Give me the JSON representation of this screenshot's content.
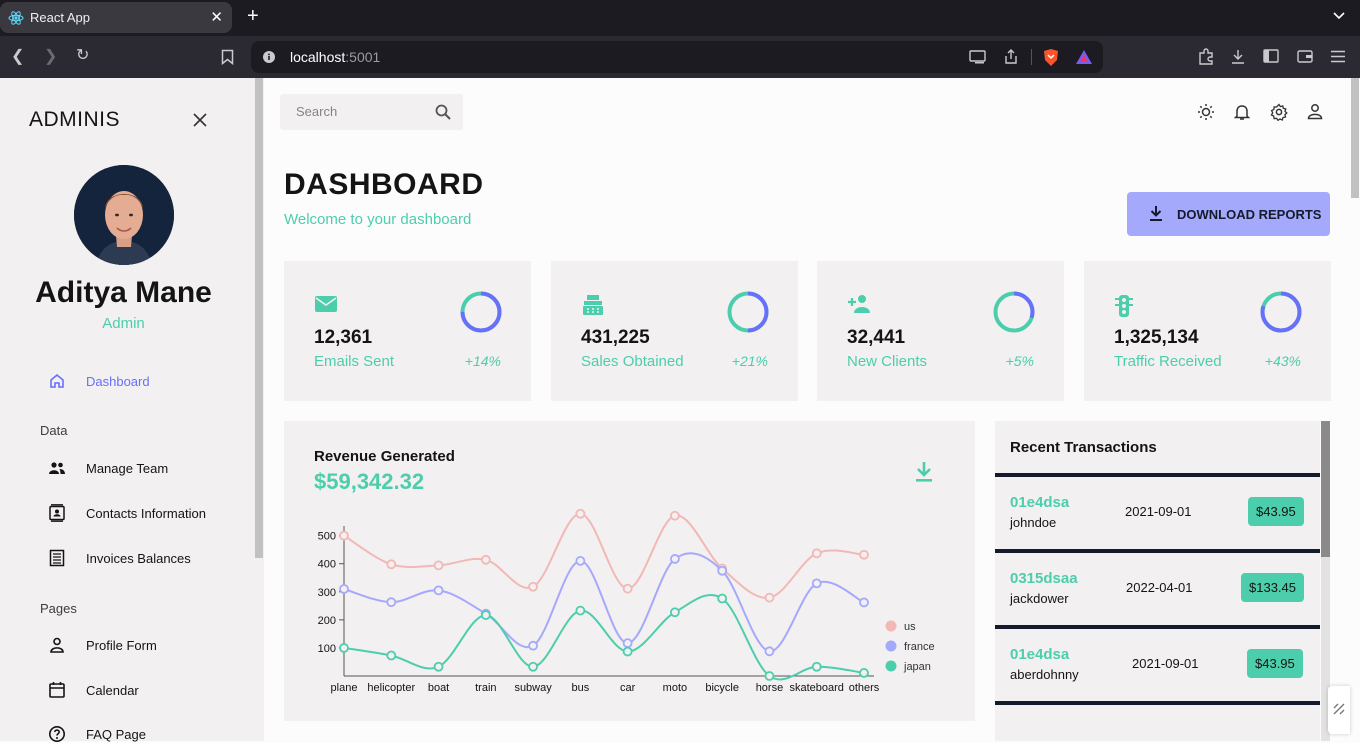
{
  "browser": {
    "tab_title": "React App",
    "url_host": "localhost",
    "url_port": ":5001"
  },
  "sidebar": {
    "brand": "ADMINIS",
    "user_name": "Aditya Mane",
    "user_role": "Admin",
    "items": [
      {
        "label": "Dashboard",
        "icon": "home-icon",
        "active": true
      },
      {
        "label": "Manage Team",
        "icon": "people-icon"
      },
      {
        "label": "Contacts Information",
        "icon": "contacts-icon"
      },
      {
        "label": "Invoices Balances",
        "icon": "receipt-icon"
      },
      {
        "label": "Profile Form",
        "icon": "person-icon"
      },
      {
        "label": "Calendar",
        "icon": "calendar-icon"
      },
      {
        "label": "FAQ Page",
        "icon": "help-icon"
      }
    ],
    "sections": [
      "Data",
      "Pages"
    ]
  },
  "topbar": {
    "search_placeholder": "Search"
  },
  "header": {
    "title": "DASHBOARD",
    "subtitle": "Welcome to your dashboard",
    "download_label": "DOWNLOAD REPORTS"
  },
  "stats": [
    {
      "value": "12,361",
      "label": "Emails Sent",
      "increase": "+14%",
      "progress": 0.75,
      "icon": "email-icon"
    },
    {
      "value": "431,225",
      "label": "Sales Obtained",
      "increase": "+21%",
      "progress": 0.5,
      "icon": "point-of-sale-icon"
    },
    {
      "value": "32,441",
      "label": "New Clients",
      "increase": "+5%",
      "progress": 0.3,
      "icon": "person-add-icon"
    },
    {
      "value": "1,325,134",
      "label": "Traffic Received",
      "increase": "+43%",
      "progress": 0.8,
      "icon": "traffic-icon"
    }
  ],
  "revenue": {
    "title": "Revenue Generated",
    "amount": "$59,342.32"
  },
  "chart_data": {
    "type": "line",
    "categories": [
      "plane",
      "helicopter",
      "boat",
      "train",
      "subway",
      "bus",
      "car",
      "moto",
      "bicycle",
      "horse",
      "skateboard",
      "others"
    ],
    "series": [
      {
        "name": "us",
        "color": "#f2b8b5",
        "values": [
          500,
          398,
          394,
          414,
          318,
          578,
          311,
          571,
          383,
          279,
          437,
          432
        ]
      },
      {
        "name": "france",
        "color": "#a4a9fc",
        "values": [
          310,
          263,
          305,
          222,
          108,
          410,
          117,
          417,
          375,
          88,
          330,
          262
        ]
      },
      {
        "name": "japan",
        "color": "#4cceac",
        "values": [
          100,
          73,
          33,
          217,
          33,
          233,
          87,
          227,
          276,
          0,
          33,
          11
        ]
      }
    ],
    "yticks": [
      100,
      200,
      300,
      400,
      500
    ],
    "ylim": [
      0,
      570
    ],
    "legend": "right"
  },
  "transactions": {
    "title": "Recent Transactions",
    "rows": [
      {
        "txId": "01e4dsa",
        "user": "johndoe",
        "date": "2021-09-01",
        "cost": "$43.95"
      },
      {
        "txId": "0315dsaa",
        "user": "jackdower",
        "date": "2022-04-01",
        "cost": "$133.45"
      },
      {
        "txId": "01e4dsa",
        "user": "aberdohnny",
        "date": "2021-09-01",
        "cost": "$43.95"
      }
    ]
  },
  "colors": {
    "accent_green": "#4cceac",
    "accent_blue": "#a4a9fc",
    "dark": "#141b2d",
    "panel": "#f2f0f0"
  }
}
